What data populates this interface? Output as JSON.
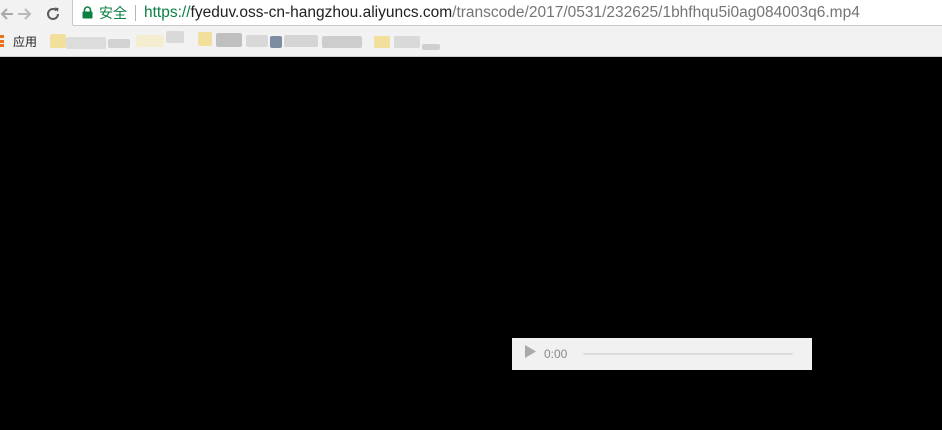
{
  "browser": {
    "security_label": "安全",
    "url": {
      "scheme": "https://",
      "host": "fyeduv.oss-cn-hangzhou.aliyuncs.com",
      "path": "/transcode/2017/0531/232625/1bhfhqu5i0ag084003q6.mp4"
    },
    "bookmarks_bar": {
      "apps_label": "应用"
    },
    "icons": {
      "back": "back-arrow-icon",
      "forward": "forward-arrow-icon",
      "reload": "reload-icon",
      "lock": "lock-icon",
      "apps": "apps-grid-icon"
    },
    "colors": {
      "secure_green": "#0b8043",
      "host_text": "#212121",
      "path_text": "#757575",
      "page_background": "#000000"
    }
  },
  "media_player": {
    "current_time": "0:00",
    "progress": 0,
    "icons": {
      "play": "play-icon"
    }
  }
}
